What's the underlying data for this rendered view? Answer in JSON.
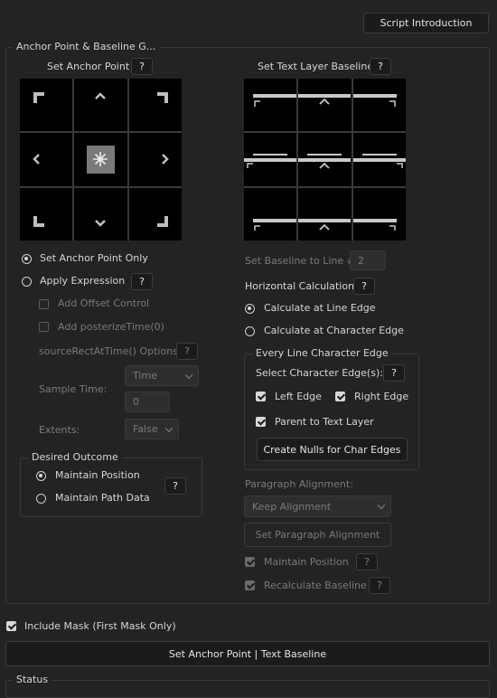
{
  "header": {
    "script_intro_label": "Script Introduction"
  },
  "main_panel": {
    "legend": "Anchor Point & Baseline G..."
  },
  "anchor": {
    "title": "Set Anchor Point",
    "help": "?",
    "grid": [
      "top-left",
      "top",
      "top-right",
      "left",
      "center",
      "right",
      "bottom-left",
      "bottom",
      "bottom-right"
    ],
    "selected": "center"
  },
  "baseline": {
    "title": "Set Text Layer Baseline",
    "help": "?"
  },
  "options": {
    "set_anchor_only": "Set Anchor Point Only",
    "apply_expression": "Apply Expression",
    "apply_expression_help": "?",
    "add_offset": "Add Offset Control",
    "add_posterize": "Add posterizeTime(0)",
    "source_rect": "sourceRectAtTime() Options:",
    "source_rect_help": "?",
    "sample_time_label": "Sample Time:",
    "sample_time_value": "Time",
    "sample_time_number": "0",
    "extents_label": "Extents:",
    "extents_value": "False"
  },
  "outcome": {
    "legend": "Desired Outcome",
    "maintain_position": "Maintain Position",
    "maintain_path": "Maintain Path Data",
    "help": "?"
  },
  "baseline_opts": {
    "line_label": "Set Baseline to Line #:",
    "line_value": "2",
    "horizontal_label": "Horizontal Calculation:",
    "horizontal_help": "?",
    "calc_line": "Calculate at Line Edge",
    "calc_char": "Calculate at Character Edge"
  },
  "every_line": {
    "legend": "Every Line Character Edge",
    "select_label": "Select Character Edge(s):",
    "select_help": "?",
    "left_edge": "Left Edge",
    "right_edge": "Right Edge",
    "parent": "Parent to Text Layer",
    "create_nulls": "Create Nulls for Char Edges"
  },
  "paragraph": {
    "label": "Paragraph Alignment:",
    "value": "Keep Alignment",
    "set_button": "Set Paragraph Alignment",
    "maintain_position": "Maintain Position",
    "maintain_help": "?",
    "recalc_baseline": "Recalculate Baseline",
    "recalc_help": "?"
  },
  "footer": {
    "include_mask": "Include Mask (First Mask Only)",
    "main_button": "Set Anchor Point | Text Baseline",
    "status_legend": "Status"
  }
}
